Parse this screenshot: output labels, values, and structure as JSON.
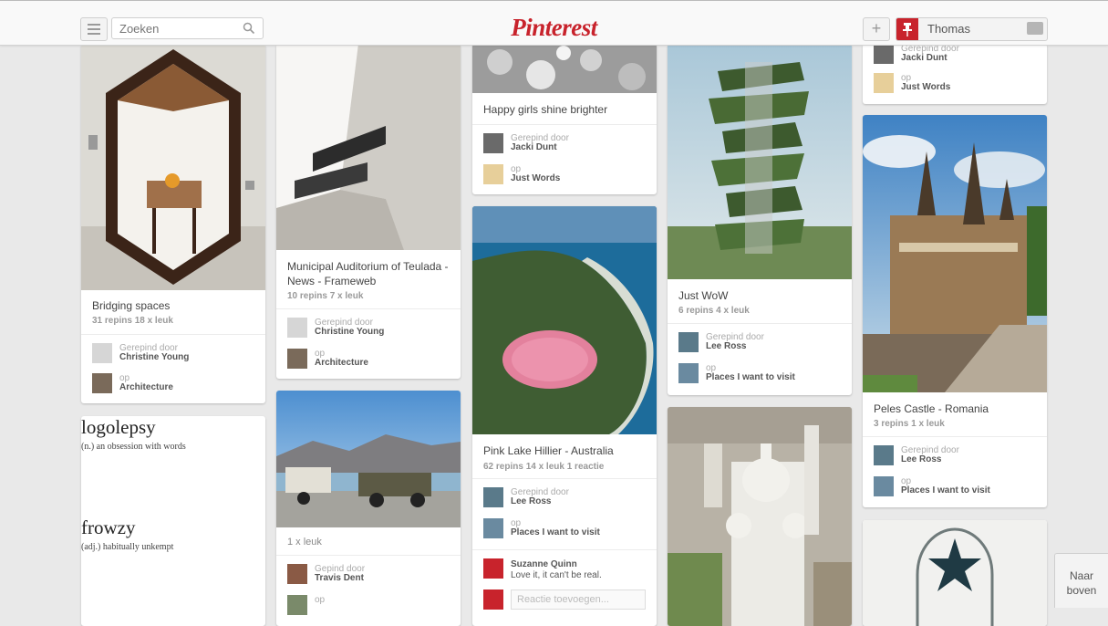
{
  "header": {
    "logo": "Pinterest",
    "search_placeholder": "Zoeken",
    "user_name": "Thomas"
  },
  "pins": {
    "bridging": {
      "title": "Bridging spaces",
      "stats": "31 repins   18 x leuk",
      "pinned_label": "Gerepind door",
      "pinned_by": "Christine Young",
      "board_label": "op",
      "board": "Architecture"
    },
    "logolepsy": {
      "word1": "logolepsy",
      "def1": "(n.) an obsession with words",
      "word2": "frowzy",
      "def2": "(adj.) habitually unkempt"
    },
    "teulada": {
      "title": "Municipal Auditorium of Teulada - News - Frameweb",
      "stats": "10 repins   7 x leuk",
      "pinned_label": "Gerepind door",
      "pinned_by": "Christine Young",
      "board_label": "op",
      "board": "Architecture"
    },
    "jeep": {
      "stats": "1 x leuk",
      "pinned_label": "Gepind door",
      "pinned_by": "Travis Dent",
      "board_label": "op"
    },
    "happy": {
      "title": "Happy girls shine brighter",
      "pinned_label": "Gerepind door",
      "pinned_by": "Jacki Dunt",
      "board_label": "op",
      "board": "Just Words"
    },
    "pink": {
      "title": "Pink Lake Hillier - Australia",
      "stats": "62 repins   14 x leuk   1 reactie",
      "pinned_label": "Gerepind door",
      "pinned_by": "Lee Ross",
      "board_label": "op",
      "board": "Places I want to visit",
      "commenter": "Suzanne Quinn",
      "comment": "Love it, it can't be real.",
      "reply_placeholder": "Reactie toevoegen..."
    },
    "wow": {
      "title": "Just WoW",
      "stats": "6 repins   4 x leuk",
      "pinned_label": "Gerepind door",
      "pinned_by": "Lee Ross",
      "board_label": "op",
      "board": "Places I want to visit"
    },
    "col5top": {
      "pinned_label": "Gerepind door",
      "pinned_by": "Jacki Dunt",
      "board_label": "op",
      "board": "Just Words"
    },
    "peles": {
      "title": "Peles Castle - Romania",
      "stats": "3 repins   1 x leuk",
      "pinned_label": "Gerepind door",
      "pinned_by": "Lee Ross",
      "board_label": "op",
      "board": "Places I want to visit"
    }
  },
  "back_to_top": {
    "line1": "Naar",
    "line2": "boven"
  }
}
